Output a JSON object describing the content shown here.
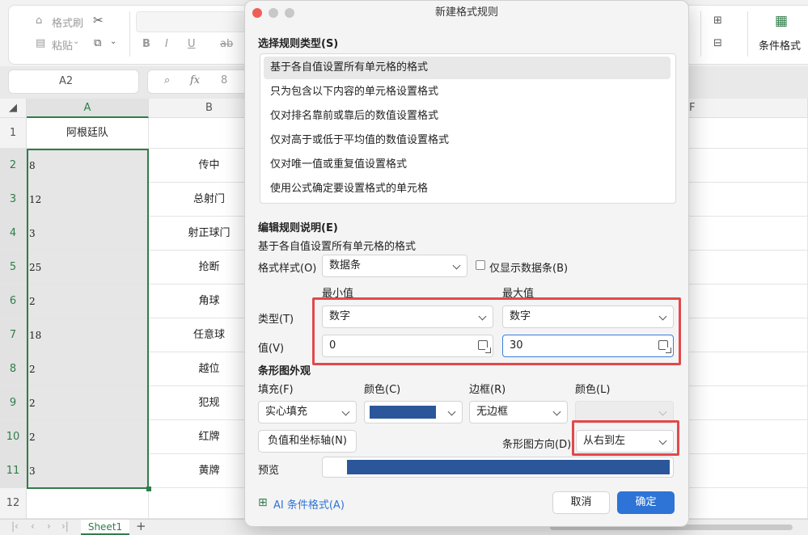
{
  "ribbon": {
    "format_painter": "格式刷",
    "paste": "粘贴",
    "bold": "B",
    "italic": "I",
    "underline": "U",
    "strike": "ab",
    "conditional_format": "条件格式"
  },
  "formula_bar": {
    "cell_ref": "A2",
    "fx": "fx",
    "value": "8"
  },
  "columns": [
    "A",
    "B",
    "F"
  ],
  "rows": [
    {
      "num": "1",
      "a": "阿根廷队",
      "b": ""
    },
    {
      "num": "2",
      "a": "8",
      "b": "传中"
    },
    {
      "num": "3",
      "a": "12",
      "b": "总射门"
    },
    {
      "num": "4",
      "a": "3",
      "b": "射正球门"
    },
    {
      "num": "5",
      "a": "25",
      "b": "抢断"
    },
    {
      "num": "6",
      "a": "2",
      "b": "角球"
    },
    {
      "num": "7",
      "a": "18",
      "b": "任意球"
    },
    {
      "num": "8",
      "a": "2",
      "b": "越位"
    },
    {
      "num": "9",
      "a": "2",
      "b": "犯规"
    },
    {
      "num": "10",
      "a": "2",
      "b": "红牌"
    },
    {
      "num": "11",
      "a": "3",
      "b": "黄牌"
    },
    {
      "num": "12",
      "a": "",
      "b": ""
    }
  ],
  "sheet_tab": "Sheet1",
  "dialog": {
    "title": "新建格式规则",
    "select_rule_type": "选择规则类型(S)",
    "rule_types": [
      "基于各自值设置所有单元格的格式",
      "只为包含以下内容的单元格设置格式",
      "仅对排名靠前或靠后的数值设置格式",
      "仅对高于或低于平均值的数值设置格式",
      "仅对唯一值或重复值设置格式",
      "使用公式确定要设置格式的单元格"
    ],
    "edit_rule": "编辑规则说明(E)",
    "edit_rule_sub": "基于各自值设置所有单元格的格式",
    "format_style_label": "格式样式(O)",
    "format_style_value": "数据条",
    "show_bar_only": "仅显示数据条(B)",
    "min_label": "最小值",
    "max_label": "最大值",
    "type_label": "类型(T)",
    "min_type": "数字",
    "max_type": "数字",
    "value_label": "值(V)",
    "min_value": "0",
    "max_value": "30",
    "bar_appearance": "条形图外观",
    "fill_label": "填充(F)",
    "color_label": "颜色(C)",
    "border_label": "边框(R)",
    "border_color_label": "颜色(L)",
    "fill_value": "实心填充",
    "border_value": "无边框",
    "negative_axis": "负值和坐标轴(N)",
    "bar_direction_label": "条形图方向(D)",
    "bar_direction_value": "从右到左",
    "preview_label": "预览",
    "ai_format": "AI 条件格式(A)",
    "cancel": "取消",
    "ok": "确定"
  },
  "colors": {
    "bar_fill": "#2b579a",
    "highlight": "#e2494b",
    "primary": "#2e74d6",
    "selection": "#2f7d4a"
  }
}
